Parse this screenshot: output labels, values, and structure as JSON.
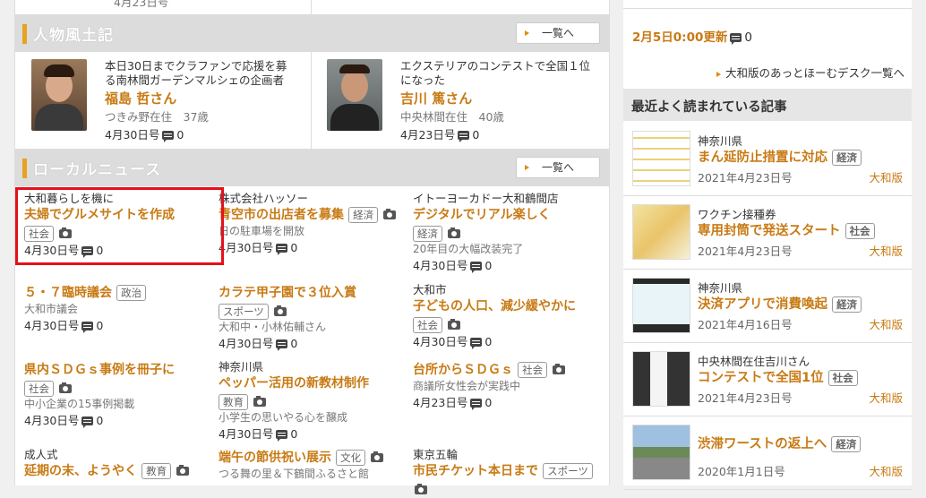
{
  "top_dates": [
    "4月23日号"
  ],
  "sections": {
    "people": {
      "title": "人物風土記",
      "list_label": "一覧へ"
    },
    "local": {
      "title": "ローカルニュース",
      "list_label": "一覧へ"
    }
  },
  "people": [
    {
      "blurb": "本日30日までクラファンで応援を募る南林間ガーデンマルシェの企画者",
      "name": "福島 哲さん",
      "sub": "つきみ野在住　37歳",
      "date": "4月30日号",
      "comments": "0"
    },
    {
      "blurb": "エクステリアのコンテストで全国１位になった",
      "name": "吉川 篤さん",
      "sub": "中央林間在住　40歳",
      "date": "4月23日号",
      "comments": "0"
    }
  ],
  "news": [
    {
      "kicker": "大和暮らしを機に",
      "head": "夫婦でグルメサイトを作成",
      "tags": [
        "社会"
      ],
      "camera": true,
      "desc": "",
      "date": "4月30日号",
      "comments": "0"
    },
    {
      "kicker": "株式会社ハッソー",
      "head": "青空市の出店者を募集",
      "tags": [
        "経済"
      ],
      "camera": true,
      "desc": "日の駐車場を開放",
      "date": "4月30日号",
      "comments": "0"
    },
    {
      "kicker": "イトーヨーカドー大和鶴間店",
      "head": "デジタルでリアル楽しく",
      "tags": [
        "経済"
      ],
      "camera": true,
      "desc": "20年目の大幅改装完了",
      "date": "4月30日号",
      "comments": "0"
    },
    {
      "kicker": "",
      "head": "５・７臨時議会",
      "tags": [
        "政治"
      ],
      "camera": false,
      "desc": "大和市議会",
      "date": "4月30日号",
      "comments": "0"
    },
    {
      "kicker": "",
      "head": "カラテ甲子園で３位入賞",
      "tags": [
        "スポーツ"
      ],
      "camera": true,
      "desc": "大和中・小林佑輔さん",
      "date": "4月30日号",
      "comments": "0"
    },
    {
      "kicker": "大和市",
      "head": "子どもの人口、減少緩やかに",
      "tags": [
        "社会"
      ],
      "camera": true,
      "desc": "",
      "date": "4月30日号",
      "comments": "0"
    },
    {
      "kicker": "",
      "head": "県内ＳＤＧｓ事例を冊子に",
      "tags": [
        "社会"
      ],
      "camera": true,
      "desc": "中小企業の15事例掲載",
      "date": "4月30日号",
      "comments": "0"
    },
    {
      "kicker": "神奈川県",
      "head": "ペッパー活用の新教材制作",
      "tags": [
        "教育"
      ],
      "camera": true,
      "desc": "小学生の思いやる心を醸成",
      "date": "4月30日号",
      "comments": "0"
    },
    {
      "kicker": "",
      "head": "台所からＳＤＧｓ",
      "tags": [
        "社会"
      ],
      "camera": true,
      "desc": "商議所女性会が実践中",
      "date": "4月23日号",
      "comments": "0"
    },
    {
      "kicker": "成人式",
      "head": "延期の末、ようやく",
      "tags": [
        "教育"
      ],
      "camera": true,
      "desc": "",
      "date": "",
      "comments": ""
    },
    {
      "kicker": "",
      "head": "端午の節供祝い展示",
      "tags": [
        "文化"
      ],
      "camera": true,
      "desc": "つる舞の里＆下鶴間ふるさと館",
      "date": "",
      "comments": ""
    },
    {
      "kicker": "東京五輪",
      "head": "市民チケット本日まで",
      "tags": [
        "スポーツ"
      ],
      "camera": true,
      "desc": "",
      "date": "",
      "comments": ""
    }
  ],
  "sidebar": {
    "update": "2月5日0:00更新",
    "update_comments": "0",
    "desk_link": "大和版のあっとほーむデスク一覧へ",
    "popular_title": "最近よく読まれている記事",
    "popular": [
      {
        "kicker": "神奈川県",
        "title": "まん延防止措置に対応",
        "tag": "経済",
        "date": "2021年4月23日号",
        "edition": "大和版"
      },
      {
        "kicker": "ワクチン接種券",
        "title": "専用封筒で発送スタート",
        "tag": "社会",
        "date": "2021年4月23日号",
        "edition": "大和版"
      },
      {
        "kicker": "神奈川県",
        "title": "決済アプリで消費喚起",
        "tag": "経済",
        "date": "2021年4月16日号",
        "edition": "大和版"
      },
      {
        "kicker": "中央林間在住吉川さん",
        "title": "コンテストで全国1位",
        "tag": "社会",
        "date": "2021年4月23日号",
        "edition": "大和版"
      },
      {
        "kicker": "",
        "title": "渋滞ワーストの返上へ",
        "tag": "経済",
        "date": "2020年1月1日号",
        "edition": "大和版"
      }
    ]
  }
}
